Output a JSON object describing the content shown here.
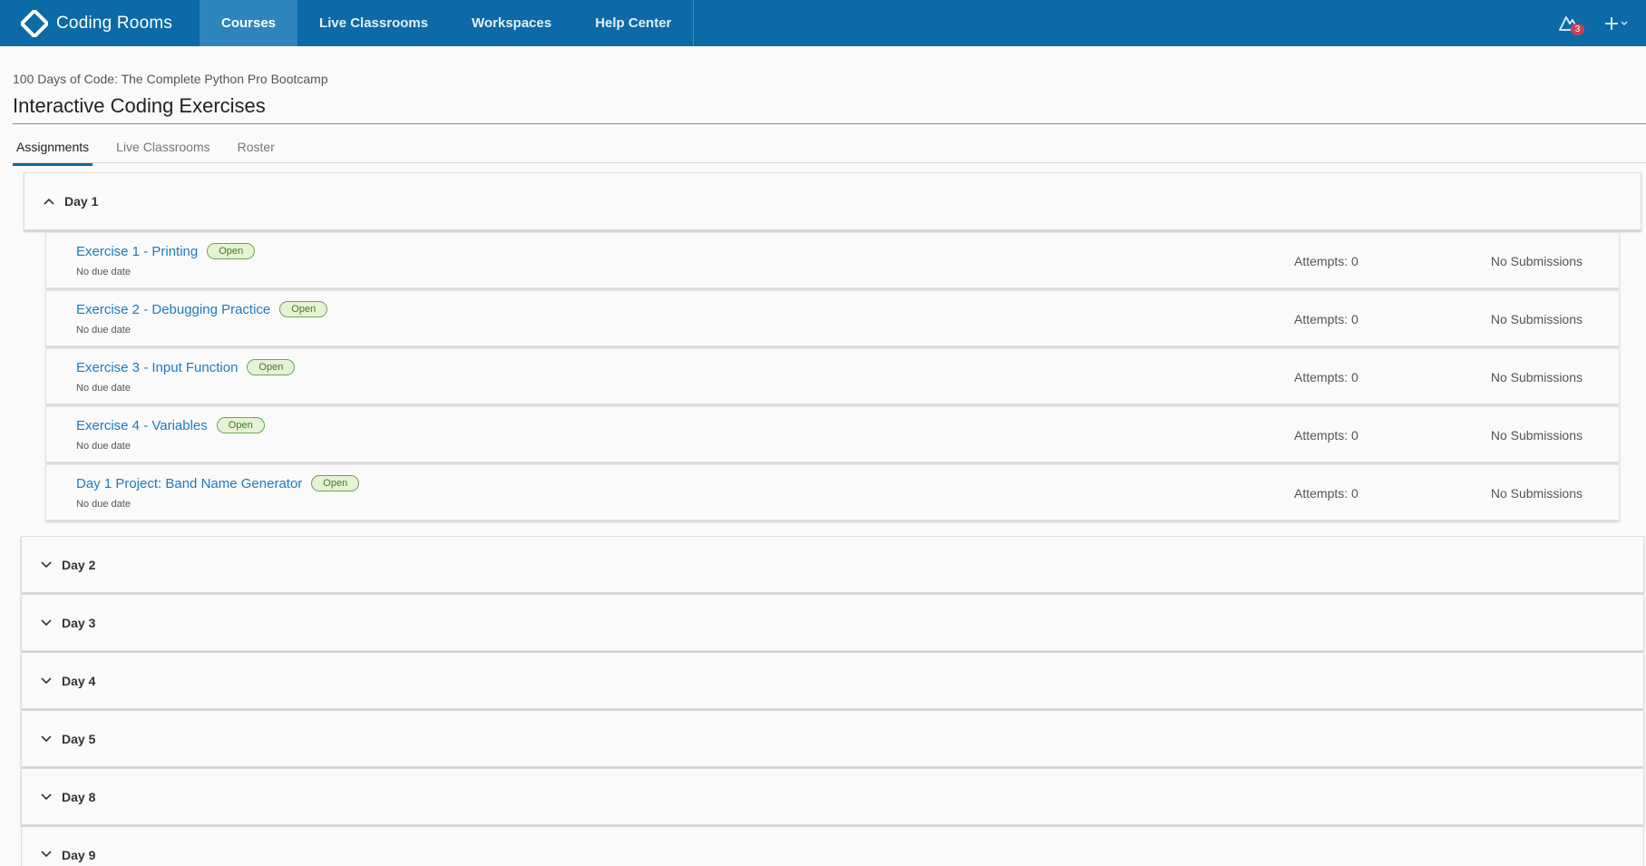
{
  "brand": {
    "name": "Coding Rooms"
  },
  "nav": {
    "links": [
      "Courses",
      "Live Classrooms",
      "Workspaces",
      "Help Center"
    ],
    "active_index": 0,
    "notifications_count": "3"
  },
  "course": {
    "name": "100 Days of Code: The Complete Python Pro Bootcamp",
    "title": "Interactive Coding Exercises"
  },
  "tabs": [
    "Assignments",
    "Live Classrooms",
    "Roster"
  ],
  "sections": [
    {
      "label": "Day 1",
      "expanded": true,
      "assignments": [
        {
          "name": "Exercise 1 - Printing",
          "status": "Open",
          "due": "No due date",
          "attempts": "Attempts: 0",
          "submissions": "No Submissions"
        },
        {
          "name": "Exercise 2 - Debugging Practice",
          "status": "Open",
          "due": "No due date",
          "attempts": "Attempts: 0",
          "submissions": "No Submissions"
        },
        {
          "name": "Exercise 3 - Input Function",
          "status": "Open",
          "due": "No due date",
          "attempts": "Attempts: 0",
          "submissions": "No Submissions"
        },
        {
          "name": "Exercise 4 - Variables",
          "status": "Open",
          "due": "No due date",
          "attempts": "Attempts: 0",
          "submissions": "No Submissions"
        },
        {
          "name": "Day 1 Project: Band Name Generator",
          "status": "Open",
          "due": "No due date",
          "attempts": "Attempts: 0",
          "submissions": "No Submissions"
        }
      ]
    },
    {
      "label": "Day 2",
      "expanded": false
    },
    {
      "label": "Day 3",
      "expanded": false
    },
    {
      "label": "Day 4",
      "expanded": false
    },
    {
      "label": "Day 5",
      "expanded": false
    },
    {
      "label": "Day 8",
      "expanded": false
    },
    {
      "label": "Day 9",
      "expanded": false
    }
  ],
  "colors": {
    "header": "#0c6aa6",
    "active_nav": "#2e84bd",
    "link": "#1d7bbd",
    "open_badge": "#6aa84f"
  }
}
